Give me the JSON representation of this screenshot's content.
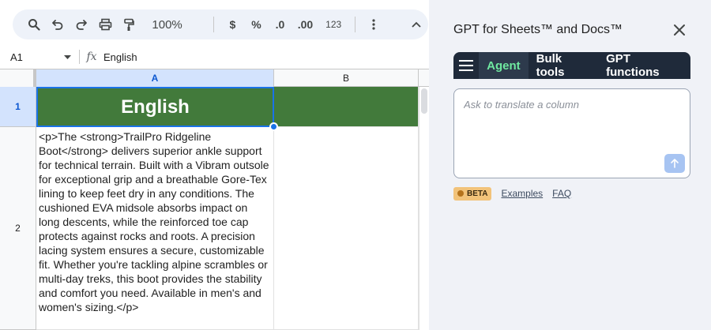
{
  "toolbar": {
    "zoom": "100%",
    "currency": "$",
    "percent": "%",
    "decrease_decimal": ".0",
    "increase_decimal": ".00",
    "number_format": "123"
  },
  "formula_bar": {
    "cell_ref": "A1",
    "fx_label": "fx",
    "value": "English"
  },
  "columns": [
    "A",
    "B"
  ],
  "rows": [
    "1",
    "2"
  ],
  "cells": {
    "a1": "English",
    "a2": "<p>The <strong>TrailPro Ridgeline Boot</strong> delivers superior ankle support for technical terrain. Built with a Vibram outsole for exceptional grip and a breathable Gore-Tex lining to keep feet dry in any conditions. The cushioned EVA midsole absorbs impact on long descents, while the reinforced toe cap protects against rocks and roots. A precision lacing system ensures a secure, customizable fit. Whether you're tackling alpine scrambles or multi-day treks, this boot provides the stability and comfort you need. Available in men's and women's sizing.</p>"
  },
  "panel": {
    "title": "GPT for Sheets™ and Docs™",
    "tabs": [
      "Agent",
      "Bulk tools",
      "GPT functions"
    ],
    "active_tab": "Agent",
    "prompt_placeholder": "Ask to translate a column",
    "beta_label": "BETA",
    "examples_link": "Examples",
    "faq_link": "FAQ"
  },
  "colors": {
    "header_fill": "#427a3b",
    "selection_blue": "#1a73e8",
    "panel_tab_bg": "#1f2a3a",
    "active_tab_text": "#6fe8a0",
    "beta_bg": "#f2c37a"
  }
}
